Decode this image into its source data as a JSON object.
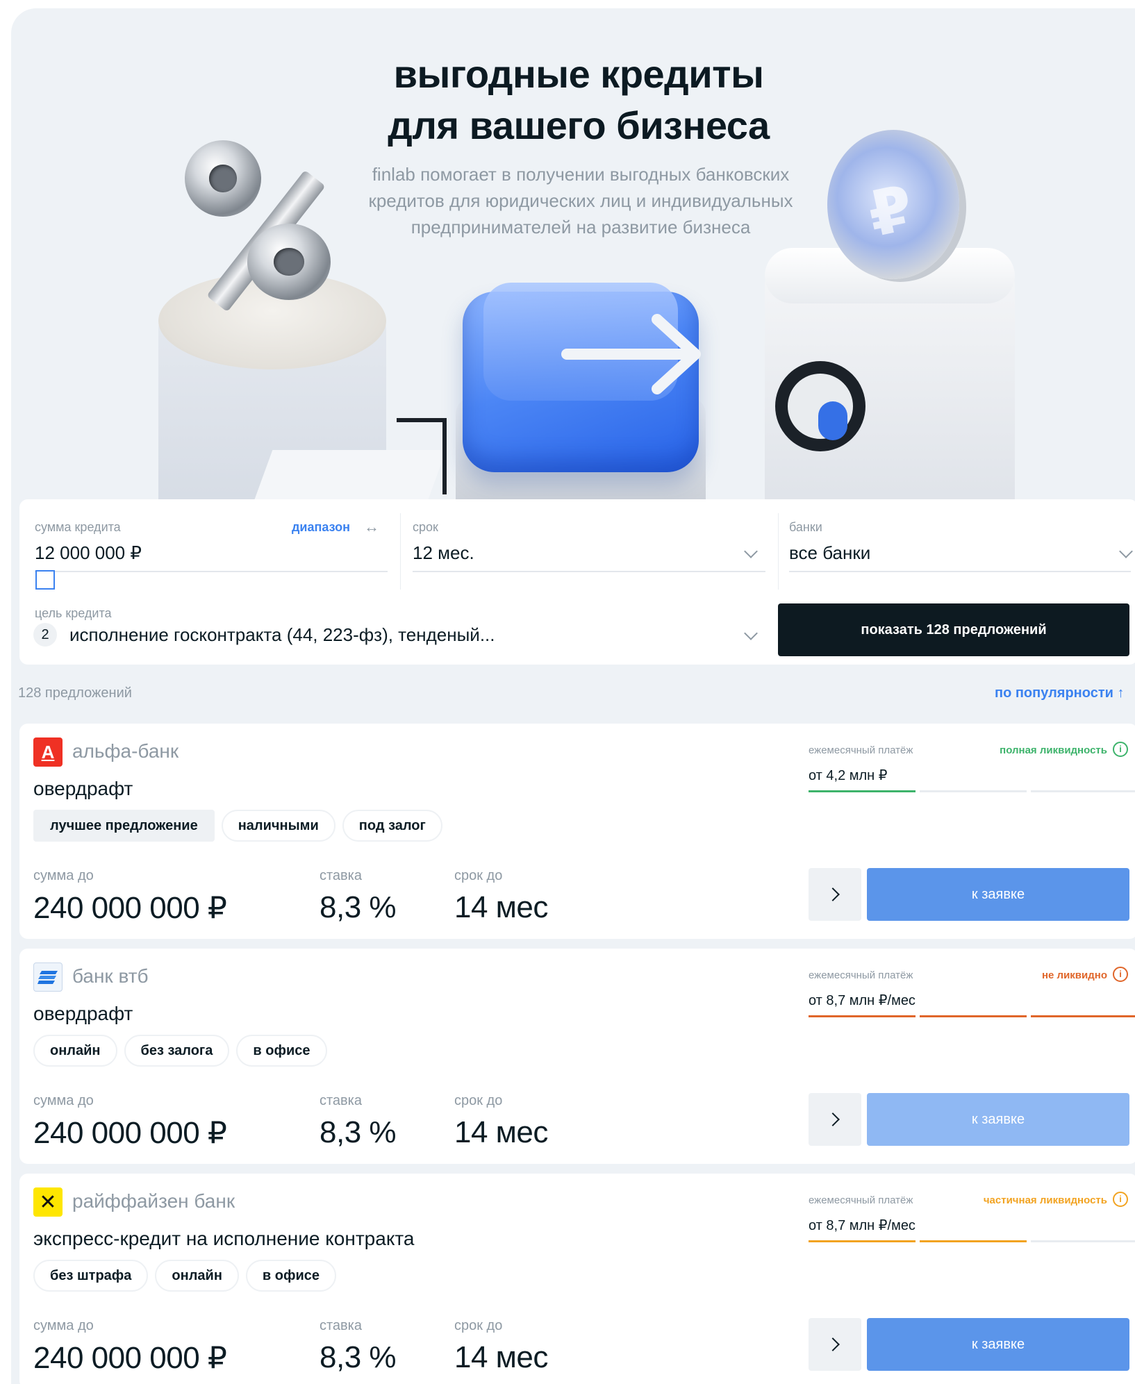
{
  "hero": {
    "title_line1": "выгодные кредиты",
    "title_line2": "для вашего бизнеса",
    "subtitle_line1": "finlab помогает в получении выгодных банковских",
    "subtitle_line2": "кредитов для юридических лиц и индивидуальных",
    "subtitle_line3": "предпринимателей на развитие бизнеса"
  },
  "filters": {
    "amount_label": "сумма кредита",
    "range_link": "диапазон",
    "range_icon": "↔",
    "amount_value": "12 000 000 ₽",
    "term_label": "срок",
    "term_value": "12 мес.",
    "banks_label": "банки",
    "banks_value": "все банки",
    "purpose_label": "цель кредита",
    "purpose_count": "2",
    "purpose_value": "исполнение госконтракта (44, 223-фз), тенденый...",
    "show_button": "показать 128 предложений"
  },
  "results": {
    "count": "128 предложений",
    "sort": "по популярности ↑"
  },
  "labels": {
    "amount": "сумма до",
    "rate": "ставка",
    "term": "срок до",
    "monthly": "ежемесячный платёж",
    "apply": "к заявке"
  },
  "colors": {
    "accent": "#3b82f0",
    "dark_button": "#0d1a21",
    "liquidity_full": "#3db36b",
    "liquidity_none": "#e0662a",
    "liquidity_partial": "#f2a321",
    "apply_active": "#5b95ea",
    "apply_disabled": "#8fb8f3"
  },
  "offers": [
    {
      "bank": "альфа-банк",
      "logo": "А",
      "product": "овердрафт",
      "tags": [
        "лучшее предложение",
        "наличными",
        "под залог"
      ],
      "amount": "240 000 000 ₽",
      "rate": "8,3 %",
      "term": "14 мес",
      "liquidity": "полная ликвидность",
      "payment": "от 4,2 млн ₽"
    },
    {
      "bank": "банк втб",
      "logo": "",
      "product": "овердрафт",
      "tags": [
        "онлайн",
        "без залога",
        "в офисе"
      ],
      "amount": "240 000 000 ₽",
      "rate": "8,3 %",
      "term": "14 мес",
      "liquidity": "не ликвидно",
      "payment": "от 8,7 млн ₽/мес"
    },
    {
      "bank": "райффайзен банк",
      "logo": "✕",
      "product": "экспресс-кредит на исполнение контракта",
      "tags": [
        "без штрафа",
        "онлайн",
        "в офисе"
      ],
      "amount": "240 000 000 ₽",
      "rate": "8,3 %",
      "term": "14 мес",
      "liquidity": "частичная ликвидность",
      "payment": "от 8,7 млн ₽/мес"
    }
  ]
}
